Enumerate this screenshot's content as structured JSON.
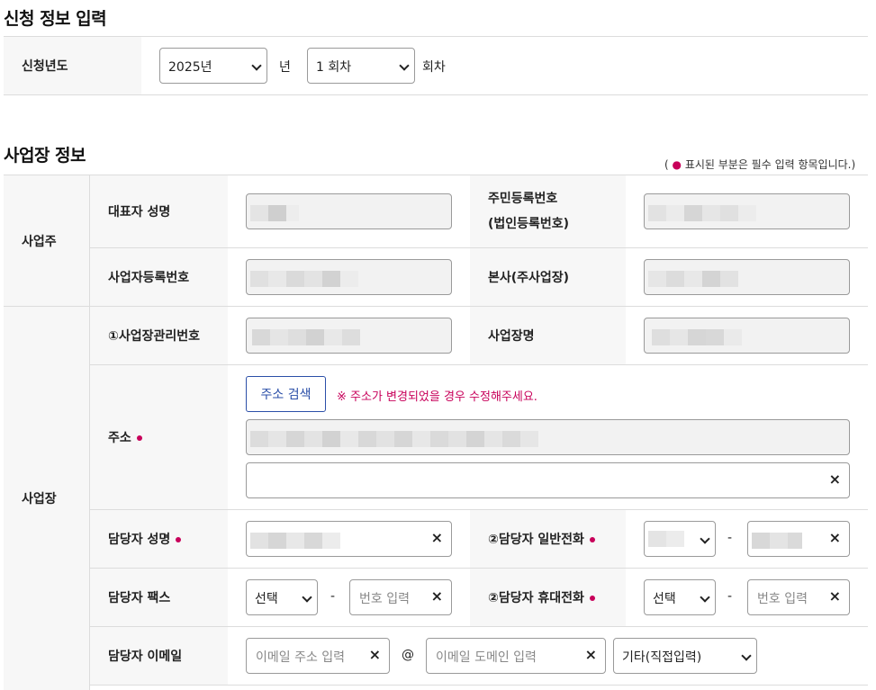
{
  "section1": {
    "title": "신청 정보 입력",
    "year_label": "신청년도",
    "year_value": "2025년",
    "year_unit": "년",
    "round_value": "1 회차",
    "round_unit": "회차"
  },
  "section2": {
    "title": "사업장 정보",
    "required_note": "( ● 표시된 부분은 필수 입력 항목입니다.)",
    "owner_group": "사업주",
    "workplace_group": "사업장",
    "rep_name_label": "대표자 성명",
    "resident_no_label_1": "주민등록번호",
    "resident_no_label_2": "(법인등록번호)",
    "biz_reg_label": "사업자등록번호",
    "hq_label": "본사(주사업장)",
    "mgmt_no_label": "①사업장관리번호",
    "workplace_name_label": "사업장명",
    "address_label": "주소",
    "address_search_btn": "주소 검색",
    "address_warning": "※ 주소가 변경되었을 경우 수정해주세요.",
    "manager_name_label": "담당자 성명",
    "manager_phone_label": "②담당자 일반전화",
    "manager_fax_label": "담당자 팩스",
    "manager_mobile_label": "②담당자 휴대전화",
    "manager_email_label": "담당자 이메일",
    "fax_prefix": "선택",
    "fax_number_placeholder": "번호 입력",
    "mobile_prefix": "선택",
    "mobile_number_placeholder": "번호 입력",
    "email_local_placeholder": "이메일 주소 입력",
    "email_at": "@",
    "email_domain_placeholder": "이메일 도메인 입력",
    "email_domain_select": "기타(직접입력)",
    "dash": "-",
    "clear_symbol": "×"
  },
  "colors": {
    "accent_blue": "#2b4fa8",
    "required_dot": "#c8005a",
    "header_bg": "#f7f7f7",
    "readonly_bg": "#f2f2f2"
  }
}
